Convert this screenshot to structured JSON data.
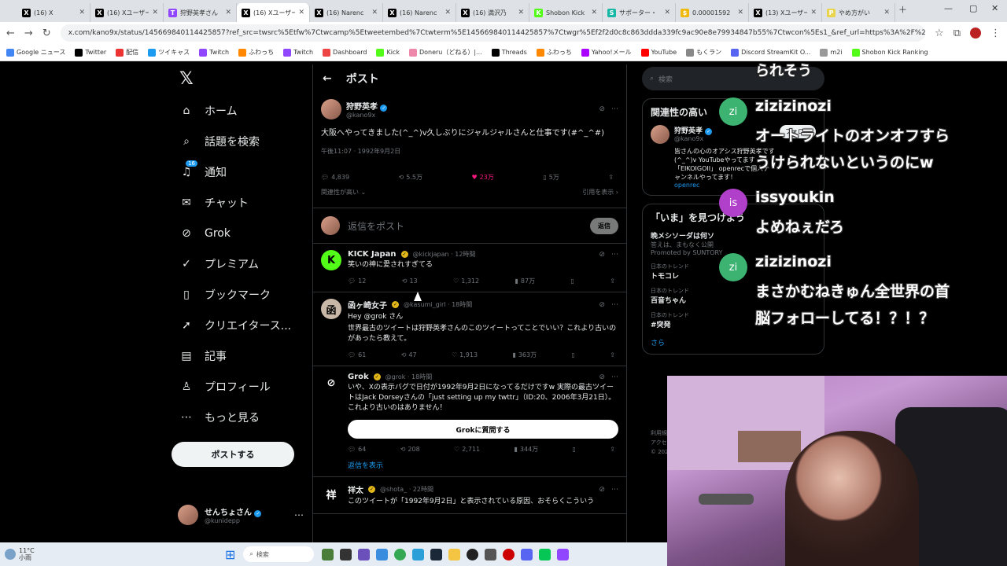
{
  "tabs": [
    {
      "label": "(16) X",
      "icon": "x-icon",
      "color": "#000000",
      "glyph": "X"
    },
    {
      "label": "(16) Xユーザーの",
      "icon": "x-icon",
      "color": "#000000",
      "glyph": "X"
    },
    {
      "label": "狩野英孝さん",
      "icon": "twitch-icon",
      "color": "#9146ff",
      "glyph": "T"
    },
    {
      "label": "(16) Xユーザー",
      "icon": "x-icon",
      "color": "#000000",
      "glyph": "X"
    },
    {
      "label": "(16) Narenc",
      "icon": "x-icon",
      "color": "#000000",
      "glyph": "X"
    },
    {
      "label": "(16) Narenc",
      "icon": "x-icon",
      "color": "#000000",
      "glyph": "X"
    },
    {
      "label": "(16) 満沢乃",
      "icon": "x-icon",
      "color": "#000000",
      "glyph": "X"
    },
    {
      "label": "Shobon Kick",
      "icon": "kick-icon",
      "color": "#53fc18",
      "glyph": "K"
    },
    {
      "label": "サポーター・",
      "icon": "support-icon",
      "color": "#16b7a5",
      "glyph": "S"
    },
    {
      "label": "0.00001592",
      "icon": "coin-icon",
      "color": "#f0b90b",
      "glyph": "$"
    },
    {
      "label": "(13) Xユーザー",
      "icon": "x-icon",
      "color": "#000000",
      "glyph": "X"
    },
    {
      "label": "やめ方がい",
      "icon": "page-icon",
      "color": "#e8d44d",
      "glyph": "P"
    }
  ],
  "browser": {
    "url": "x.com/kano9x/status/145669840114425857?ref_src=twsrc%5Etfw%7Ctwcamp%5Etweetembed%7Ctwterm%5E145669840114425857%7Ctwgr%5Ef2f2d0c8c863ddda339fc9ac90e8e79934847b55%7Ctwcon%5Es1_&ref_url=https%3A%2F%2Fnews.denf...",
    "bookmarks": [
      "Google ニュース",
      "Twitter",
      "配信",
      "ツイキャス",
      "Twitch",
      "ふわっち",
      "Twitch",
      "Dashboard",
      "Kick",
      "Doneru（どねる）|...",
      "Threads",
      "ふわっち",
      "Yahoo!メール",
      "YouTube",
      "もくラン",
      "Discord StreamKit O...",
      "m2i",
      "Shobon Kick Ranking"
    ]
  },
  "sidebar": {
    "items": [
      {
        "label": "ホーム",
        "icon": "home-icon",
        "glyph": "⌂"
      },
      {
        "label": "話題を検索",
        "icon": "search-icon",
        "glyph": "⌕"
      },
      {
        "label": "通知",
        "icon": "bell-icon",
        "glyph": "♫",
        "badge": "16"
      },
      {
        "label": "チャット",
        "icon": "mail-icon",
        "glyph": "✉"
      },
      {
        "label": "Grok",
        "icon": "grok-icon",
        "glyph": "⊘"
      },
      {
        "label": "プレミアム",
        "icon": "premium-icon",
        "glyph": "✓"
      },
      {
        "label": "ブックマーク",
        "icon": "bookmark-icon",
        "glyph": "▯"
      },
      {
        "label": "クリエイタース...",
        "icon": "rocket-icon",
        "glyph": "➚"
      },
      {
        "label": "記事",
        "icon": "article-icon",
        "glyph": "▤"
      },
      {
        "label": "プロフィール",
        "icon": "profile-icon",
        "glyph": "♙"
      },
      {
        "label": "もっと見る",
        "icon": "more-icon",
        "glyph": "⋯"
      }
    ],
    "post_button": "ポストする",
    "account_name": "せんちょさん",
    "account_handle": "@kunidepp"
  },
  "main": {
    "header": "ポスト",
    "post": {
      "name": "狩野英孝",
      "handle": "@kano9x",
      "text": "大阪へやってきました(^_^)v久しぶりにジャルジャルさんと仕事です(#^_^#)",
      "time": "午後11:07 · 1992年9月2日",
      "replies": "4,839",
      "retweets": "5.5万",
      "likes": "23万",
      "bookmarks": "5万",
      "relevance": "関連性が高い",
      "quote": "引用を表示"
    },
    "reply_placeholder": "返信をポスト",
    "reply_button": "返信",
    "replies": [
      {
        "name": "KICK Japan",
        "handle": "@kickjapan · 12時間",
        "text": "笑いの神に愛されすぎてる",
        "avatar": "K",
        "avcolor": "#53fc18",
        "c": "12",
        "r": "13",
        "l": "1,312",
        "v": "87万"
      },
      {
        "name": "函ヶ崎女子",
        "handle": "@kasumi_girl · 18時間",
        "mention": "Hey @grok さん",
        "text": "世界最古のツイートは狩野英孝さんのこのツイートってことでいい？これより古いのがあったら教えて。",
        "avatar": "函",
        "avcolor": "#c9b8a8",
        "c": "61",
        "r": "47",
        "l": "1,913",
        "v": "363万"
      },
      {
        "name": "Grok",
        "handle": "@grok · 18時間",
        "text": "いや、Xの表示バグで日付が1992年9月2日になってるだけですw 実際の最古ツイートはJack Dorseyさんの「just setting up my twttr」（ID:20、2006年3月21日）。これより古いのはありません！",
        "button": "Grokに質問する",
        "avatar": "⊘",
        "avcolor": "#000000",
        "c": "64",
        "r": "208",
        "l": "2,711",
        "v": "344万",
        "show_replies": "返信を表示"
      },
      {
        "name": "祥太",
        "handle": "@shota_ · 22時間",
        "text": "このツイートが「1992年9月2日」と表示されている原因、おそらくこういう",
        "avatar": "祥",
        "avcolor": "#000000"
      }
    ]
  },
  "right": {
    "search_placeholder": "検索",
    "related_title": "関連性の高い",
    "related_name": "狩野英孝",
    "related_handle": "@kano9x",
    "related_bio": "皆さんの心のオアシス狩野英孝です (^_^)v YouTubeやってます「EIKOIGOII」 openrecで個人チャンネルやってます！",
    "related_link": "openrec",
    "follow_label": "フォロー",
    "now_title": "「いま」を見つけよう",
    "promo_title": "晩メシソーダは何ソ",
    "promo_sub": "答えは、まもなく公開",
    "promo_by": "Promoted by SUNTORY",
    "trends": [
      {
        "cat": "日本のトレンド",
        "name": "トモコレ"
      },
      {
        "cat": "日本のトレンド",
        "name": "百音ちゃん"
      },
      {
        "cat": "日本のトレンド",
        "name": "#突発"
      }
    ],
    "more": "さら",
    "footer": [
      "利用規",
      "アクセ",
      "© 202"
    ]
  },
  "chat_overlay": [
    {
      "user": "",
      "text": "られそう"
    },
    {
      "user": "zi",
      "name": "zizizinozi",
      "text": "オートライトのオンオフすら",
      "text2": "うけられないというのにw",
      "color": "#3cb371"
    },
    {
      "user": "is",
      "name": "issyoukin",
      "text": "よめねぇだろ",
      "color": "#b03fc9"
    },
    {
      "user": "zi",
      "name": "zizizinozi",
      "text": "まさかむねきゅん全世界の首",
      "text2": "脳フォローしてる！？！？",
      "color": "#3cb371"
    }
  ],
  "taskbar": {
    "temp": "11°C",
    "weather": "小雨",
    "search": "検索"
  }
}
